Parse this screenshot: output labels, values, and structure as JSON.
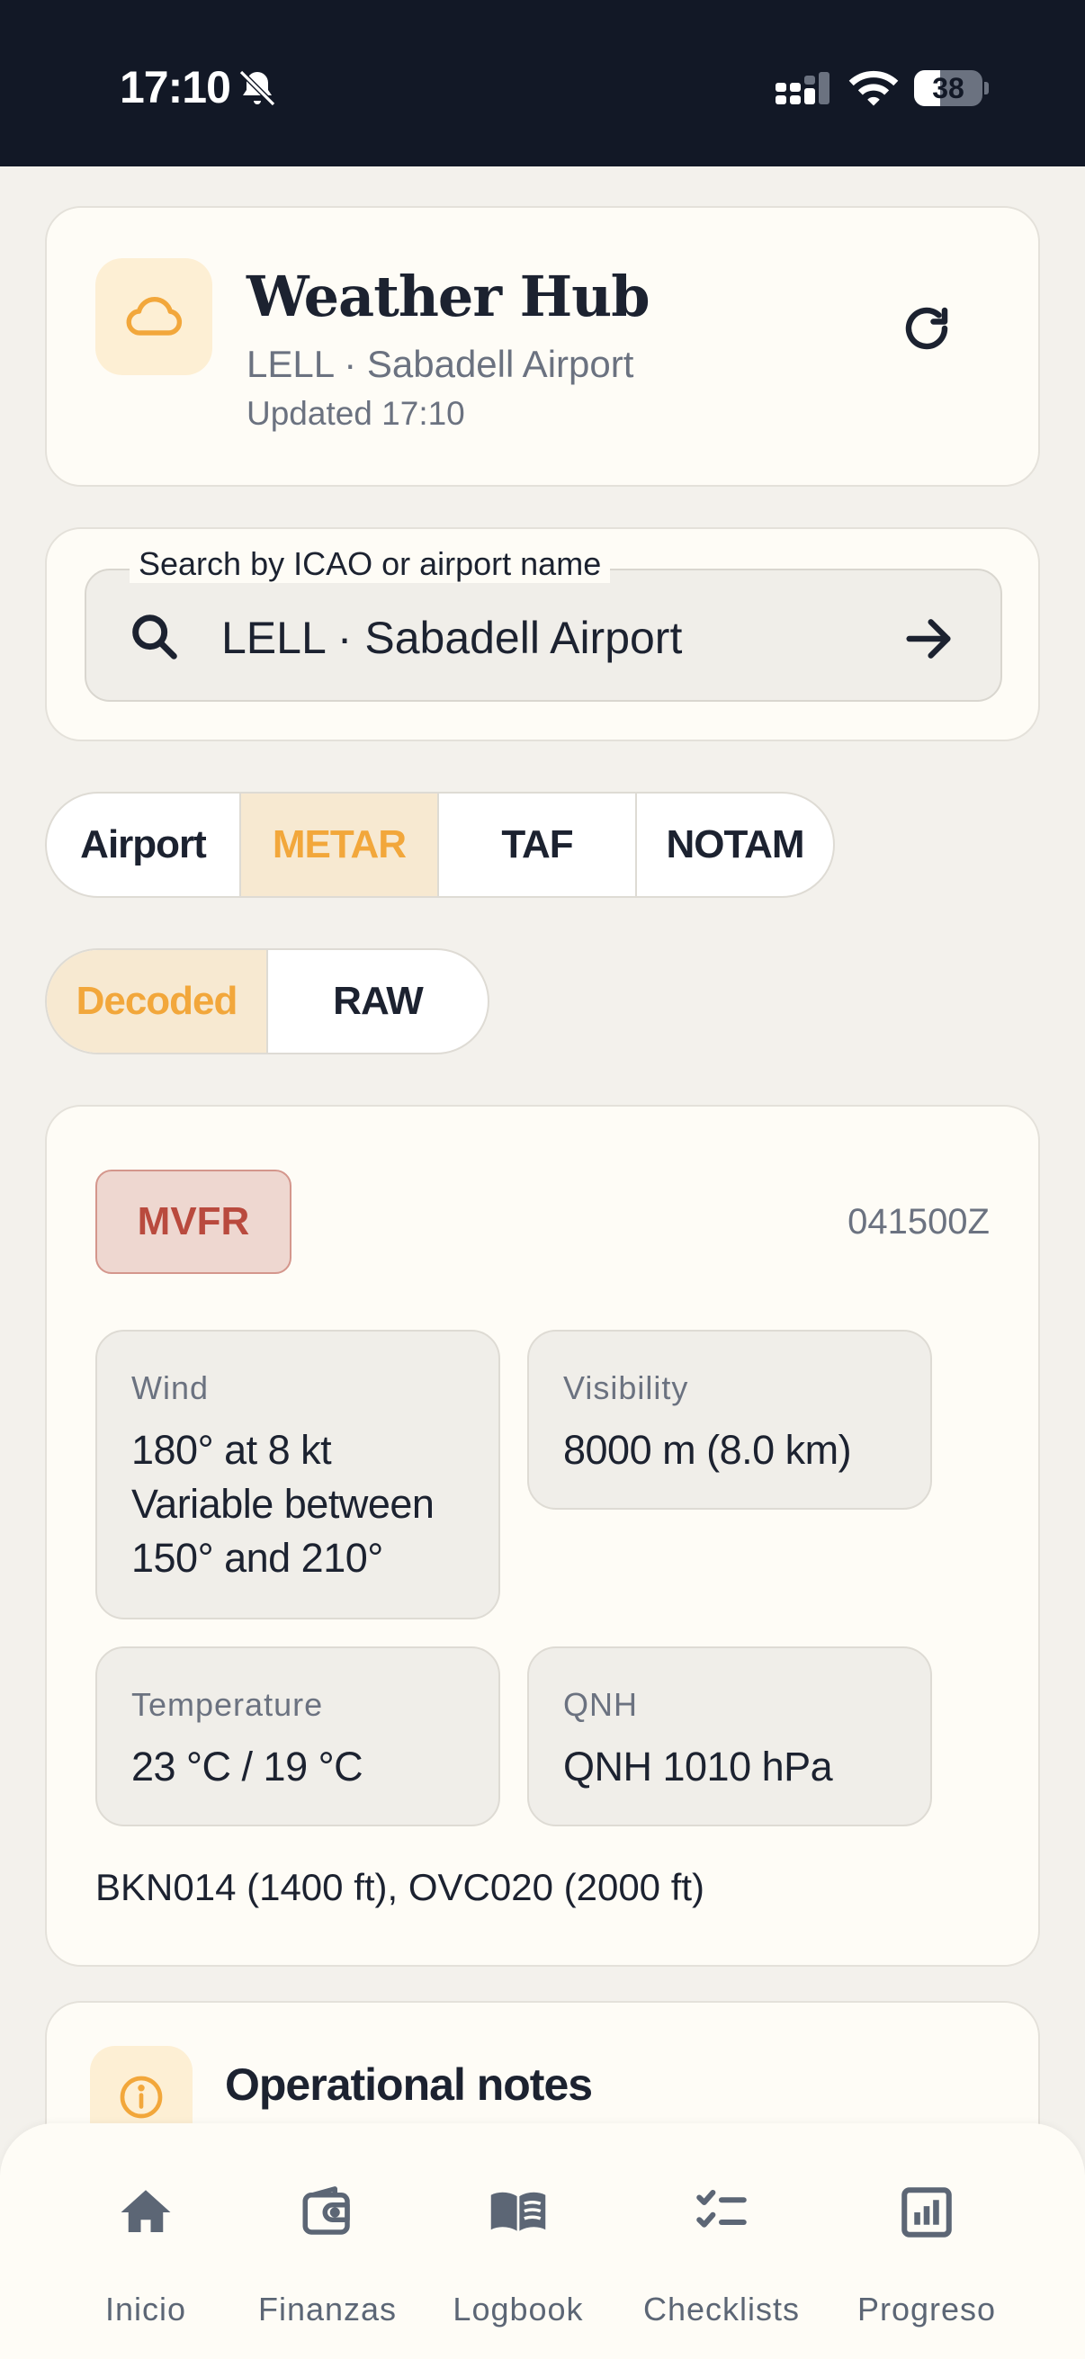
{
  "status_bar": {
    "time": "17:10",
    "battery_level": "38",
    "battery_fraction": 0.38
  },
  "header": {
    "title": "Weather Hub",
    "subtitle": "LELL · Sabadell Airport",
    "updated": "Updated 17:10",
    "icon": "cloud-icon"
  },
  "search": {
    "label": "Search by ICAO or airport name",
    "value": "LELL · Sabadell Airport"
  },
  "tabs": [
    {
      "label": "Airport",
      "active": false
    },
    {
      "label": "METAR",
      "active": true
    },
    {
      "label": "TAF",
      "active": false
    },
    {
      "label": "NOTAM",
      "active": false
    }
  ],
  "modes": [
    {
      "label": "Decoded",
      "active": true
    },
    {
      "label": "RAW",
      "active": false
    }
  ],
  "metar": {
    "category": "MVFR",
    "time": "041500Z",
    "wind": {
      "label": "Wind",
      "lines": [
        "180° at 8 kt",
        "Variable between",
        "150° and 210°"
      ]
    },
    "visibility": {
      "label": "Visibility",
      "value": "8000 m (8.0 km)"
    },
    "temperature": {
      "label": "Temperature",
      "value": "23 °C / 19 °C"
    },
    "qnh": {
      "label": "QNH",
      "value": "QNH 1010 hPa"
    },
    "clouds": "BKN014 (1400 ft), OVC020 (2000 ft)"
  },
  "notes": {
    "title": "Operational notes"
  },
  "nav": [
    {
      "label": "Inicio",
      "icon": "home-icon"
    },
    {
      "label": "Finanzas",
      "icon": "wallet-icon"
    },
    {
      "label": "Logbook",
      "icon": "book-icon"
    },
    {
      "label": "Checklists",
      "icon": "checklist-icon"
    },
    {
      "label": "Progreso",
      "icon": "chart-icon"
    }
  ],
  "colors": {
    "accent": "#f2a73b",
    "accent_bg": "#f7e9d1",
    "mvfr": "#b94a3e",
    "status_bar": "#121826"
  }
}
